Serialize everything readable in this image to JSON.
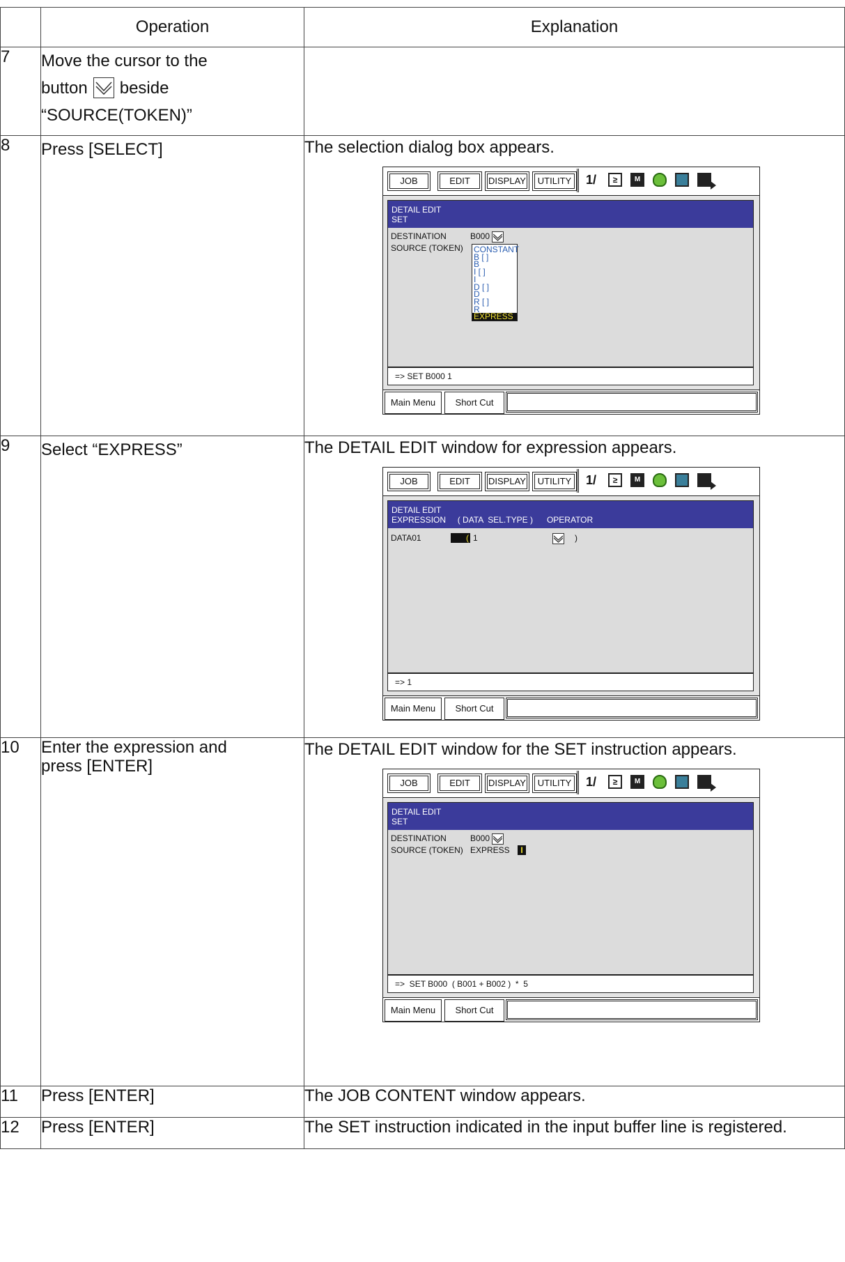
{
  "table": {
    "header": {
      "col_num": "",
      "col_operation": "Operation",
      "col_explanation": "Explanation"
    },
    "rows": [
      {
        "num": "7",
        "op_line1": "Move the cursor to the",
        "op_line2a": "button",
        "op_line2b": "beside",
        "op_line3": "“SOURCE(TOKEN)”",
        "explanation": ""
      },
      {
        "num": "8",
        "operation": "Press [SELECT]",
        "explanation": "The selection dialog box appears."
      },
      {
        "num": "9",
        "operation": "Select “EXPRESS”",
        "explanation": "The DETAIL EDIT window for expression appears."
      },
      {
        "num": "10",
        "operation_l1": "Enter the expression and",
        "operation_l2": "press [ENTER]",
        "explanation": "The DETAIL EDIT window for the SET instruction appears."
      },
      {
        "num": "11",
        "operation": "Press [ENTER]",
        "explanation": "The JOB CONTENT window appears."
      },
      {
        "num": "12",
        "operation": "Press [ENTER]",
        "explanation": "The SET instruction indicated in the input buffer line is registered."
      }
    ]
  },
  "pendant": {
    "menu": {
      "job": "JOB",
      "edit": "EDIT",
      "display": "DISPLAY",
      "utility": "UTILITY"
    },
    "bottom": {
      "main_menu": "Main Menu",
      "short_cut": "Short Cut"
    },
    "icon_names": [
      "coordinate-icon",
      "speed-icon",
      "manual-mode-icon",
      "security-icon",
      "page-icon",
      "exit-icon"
    ]
  },
  "screen1": {
    "title1": "DETAIL EDIT",
    "title2": "SET",
    "dest_label": "DESTINATION",
    "dest_value": "B000",
    "source_label": "SOURCE (TOKEN)",
    "options": [
      "CONSTANT",
      "B [ ]",
      "B",
      "I [ ]",
      "I",
      "D [ ]",
      "D",
      "R [ ]",
      "R",
      "EXPRESS"
    ],
    "selected_option": "EXPRESS",
    "buffer": "=>  SET B000  1"
  },
  "screen2": {
    "title1": "DETAIL EDIT",
    "title2": "EXPRESSION     ( DATA  SEL.TYPE )      OPERATOR",
    "data_label": "DATA01",
    "data_open": "(",
    "data_value": "1",
    "data_close": ")",
    "buffer": "=>  1"
  },
  "screen3": {
    "title1": "DETAIL EDIT",
    "title2": "SET",
    "dest_label": "DESTINATION",
    "dest_value": "B000",
    "source_label": "SOURCE (TOKEN)",
    "source_value": "EXPRESS",
    "cursor_mark": "I",
    "buffer": "=>  SET B000  ( B001 + B002 )  *  5"
  }
}
